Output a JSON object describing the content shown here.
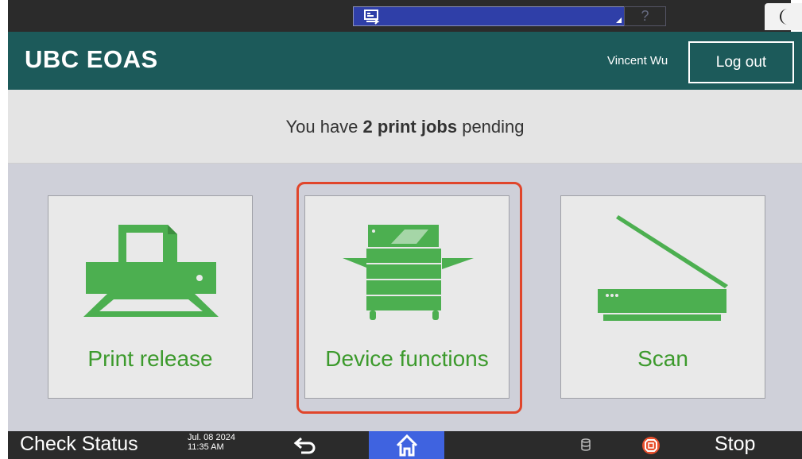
{
  "header": {
    "brand": "UBC EOAS",
    "user_name": "Vincent Wu",
    "logout_label": "Log out"
  },
  "banner": {
    "prefix": "You have ",
    "count_text": "2 print jobs",
    "suffix": " pending"
  },
  "tiles": [
    {
      "label": "Print release",
      "icon": "printer-icon"
    },
    {
      "label": "Device functions",
      "icon": "copier-icon"
    },
    {
      "label": "Scan",
      "icon": "scanner-icon"
    }
  ],
  "bottombar": {
    "check_status_label": "Check Status",
    "date": "Jul. 08 2024",
    "time": "11:35 AM",
    "stop_label": "Stop"
  },
  "colors": {
    "header_bg": "#1c5a5a",
    "tile_icon": "#4caf50",
    "tile_label": "#3c9a2c",
    "highlight": "#e0452b",
    "home_bg": "#3f63e0"
  }
}
